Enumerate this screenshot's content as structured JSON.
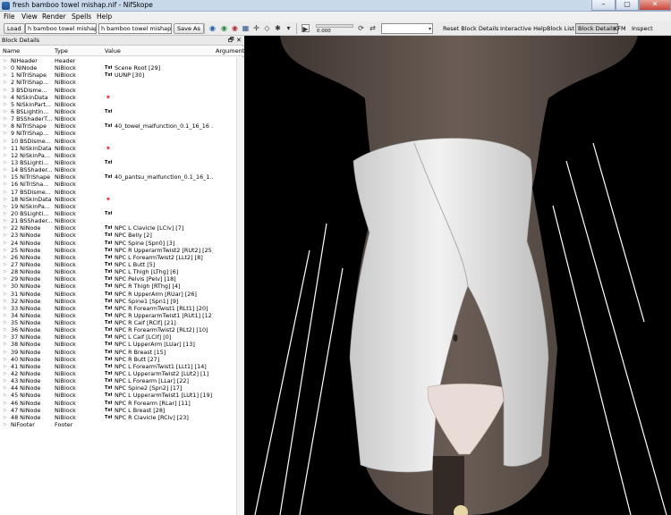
{
  "window": {
    "title": "fresh bamboo towel mishap.nif - NifSkope",
    "min": "–",
    "max": "▢",
    "close": "✕"
  },
  "menu": [
    "File",
    "View",
    "Render",
    "Spells",
    "Help"
  ],
  "toolbar": {
    "load": "Load",
    "load_path": "h bamboo towel mishap.nif",
    "save_path": "h bamboo towel mishap.nif",
    "save_as": "Save As",
    "slider_value": "0.000",
    "links": [
      "Reset Block Details",
      "Interactive Help",
      "Block List",
      "Block Details",
      "KFM",
      "Inspect"
    ]
  },
  "panel": {
    "title": "Block Details",
    "float_icon": "🗗",
    "close_icon": "✕",
    "columns": [
      "Name",
      "Type",
      "Value",
      "Argument"
    ]
  },
  "rows": [
    {
      "name": "NiHeader",
      "type": "Header",
      "tag": "",
      "value": ""
    },
    {
      "name": "0 NiNode",
      "type": "NiBlock",
      "tag": "Txt",
      "value": "Scene Root [29]"
    },
    {
      "name": "1 NiTriShape",
      "type": "NiBlock",
      "tag": "Txt",
      "value": "UUNP [30]"
    },
    {
      "name": "2 NiTriShap...",
      "type": "NiBlock",
      "tag": "",
      "value": ""
    },
    {
      "name": "3 BSDisme...",
      "type": "NiBlock",
      "tag": "",
      "value": ""
    },
    {
      "name": "4 NiSkinData",
      "type": "NiBlock",
      "tag": "x",
      "value": ""
    },
    {
      "name": "5 NiSkinPart...",
      "type": "NiBlock",
      "tag": "",
      "value": ""
    },
    {
      "name": "6 BSLightin...",
      "type": "NiBlock",
      "tag": "Txt",
      "value": ""
    },
    {
      "name": "7 BSShaderT...",
      "type": "NiBlock",
      "tag": "",
      "value": ""
    },
    {
      "name": "8 NiTriShape",
      "type": "NiBlock",
      "tag": "Txt",
      "value": "40_towel_malfunction_0.1_16_16 ..."
    },
    {
      "name": "9 NiTriShap...",
      "type": "NiBlock",
      "tag": "",
      "value": ""
    },
    {
      "name": "10 BSDisme...",
      "type": "NiBlock",
      "tag": "",
      "value": ""
    },
    {
      "name": "11 NiSkinData",
      "type": "NiBlock",
      "tag": "x",
      "value": ""
    },
    {
      "name": "12 NiSkinPa...",
      "type": "NiBlock",
      "tag": "",
      "value": ""
    },
    {
      "name": "13 BSLighti...",
      "type": "NiBlock",
      "tag": "Txt",
      "value": ""
    },
    {
      "name": "14 BSShader...",
      "type": "NiBlock",
      "tag": "",
      "value": ""
    },
    {
      "name": "15 NiTriShape",
      "type": "NiBlock",
      "tag": "Txt",
      "value": "40_pantsu_malfunction_0.1_16_1..."
    },
    {
      "name": "16 NiTriSha...",
      "type": "NiBlock",
      "tag": "",
      "value": ""
    },
    {
      "name": "17 BSDisme...",
      "type": "NiBlock",
      "tag": "",
      "value": ""
    },
    {
      "name": "18 NiSkinData",
      "type": "NiBlock",
      "tag": "x",
      "value": ""
    },
    {
      "name": "19 NiSkinPa...",
      "type": "NiBlock",
      "tag": "",
      "value": ""
    },
    {
      "name": "20 BSLighti...",
      "type": "NiBlock",
      "tag": "Txt",
      "value": ""
    },
    {
      "name": "21 BSShader...",
      "type": "NiBlock",
      "tag": "",
      "value": ""
    },
    {
      "name": "22 NiNode",
      "type": "NiBlock",
      "tag": "Txt",
      "value": "NPC L Clavicle [LClv] [7]"
    },
    {
      "name": "23 NiNode",
      "type": "NiBlock",
      "tag": "Txt",
      "value": "NPC Belly [2]"
    },
    {
      "name": "24 NiNode",
      "type": "NiBlock",
      "tag": "Txt",
      "value": "NPC Spine [Spn0] [3]"
    },
    {
      "name": "25 NiNode",
      "type": "NiBlock",
      "tag": "Txt",
      "value": "NPC R UpperarmTwist2 [RUt2] [25]"
    },
    {
      "name": "26 NiNode",
      "type": "NiBlock",
      "tag": "Txt",
      "value": "NPC L ForearmTwist2 [LLt2] [8]"
    },
    {
      "name": "27 NiNode",
      "type": "NiBlock",
      "tag": "Txt",
      "value": "NPC L Butt [5]"
    },
    {
      "name": "28 NiNode",
      "type": "NiBlock",
      "tag": "Txt",
      "value": "NPC L Thigh [LThg] [6]"
    },
    {
      "name": "29 NiNode",
      "type": "NiBlock",
      "tag": "Txt",
      "value": "NPC Pelvis [Pelv] [18]"
    },
    {
      "name": "30 NiNode",
      "type": "NiBlock",
      "tag": "Txt",
      "value": "NPC R Thigh [RThg] [4]"
    },
    {
      "name": "31 NiNode",
      "type": "NiBlock",
      "tag": "Txt",
      "value": "NPC R UpperArm [RUar] [26]"
    },
    {
      "name": "32 NiNode",
      "type": "NiBlock",
      "tag": "Txt",
      "value": "NPC Spine1 [Spn1] [9]"
    },
    {
      "name": "33 NiNode",
      "type": "NiBlock",
      "tag": "Txt",
      "value": "NPC R ForearmTwist1 [RLt1] [20]"
    },
    {
      "name": "34 NiNode",
      "type": "NiBlock",
      "tag": "Txt",
      "value": "NPC R UpperarmTwist1 [RUt1] [12]"
    },
    {
      "name": "35 NiNode",
      "type": "NiBlock",
      "tag": "Txt",
      "value": "NPC R Calf [RClf] [21]"
    },
    {
      "name": "36 NiNode",
      "type": "NiBlock",
      "tag": "Txt",
      "value": "NPC R ForearmTwist2 [RLt2] [10]"
    },
    {
      "name": "37 NiNode",
      "type": "NiBlock",
      "tag": "Txt",
      "value": "NPC L Calf [LClf] [0]"
    },
    {
      "name": "38 NiNode",
      "type": "NiBlock",
      "tag": "Txt",
      "value": "NPC L UpperArm [LUar] [13]"
    },
    {
      "name": "39 NiNode",
      "type": "NiBlock",
      "tag": "Txt",
      "value": "NPC R Breast [15]"
    },
    {
      "name": "40 NiNode",
      "type": "NiBlock",
      "tag": "Txt",
      "value": "NPC R Butt [27]"
    },
    {
      "name": "41 NiNode",
      "type": "NiBlock",
      "tag": "Txt",
      "value": "NPC L ForearmTwist1 [LLt1] [14]"
    },
    {
      "name": "42 NiNode",
      "type": "NiBlock",
      "tag": "Txt",
      "value": "NPC L UpperarmTwist2 [LUt2] [1]"
    },
    {
      "name": "43 NiNode",
      "type": "NiBlock",
      "tag": "Txt",
      "value": "NPC L Forearm [LLar] [22]"
    },
    {
      "name": "44 NiNode",
      "type": "NiBlock",
      "tag": "Txt",
      "value": "NPC Spine2 [Spn2] [17]"
    },
    {
      "name": "45 NiNode",
      "type": "NiBlock",
      "tag": "Txt",
      "value": "NPC L UpperarmTwist1 [LUt1] [19]"
    },
    {
      "name": "46 NiNode",
      "type": "NiBlock",
      "tag": "Txt",
      "value": "NPC R Forearm [RLar] [11]"
    },
    {
      "name": "47 NiNode",
      "type": "NiBlock",
      "tag": "Txt",
      "value": "NPC L Breast [28]"
    },
    {
      "name": "48 NiNode",
      "type": "NiBlock",
      "tag": "Txt",
      "value": "NPC R Clavicle [RClv] [23]"
    },
    {
      "name": "NiFooter",
      "type": "Footer",
      "tag": "",
      "value": ""
    }
  ]
}
